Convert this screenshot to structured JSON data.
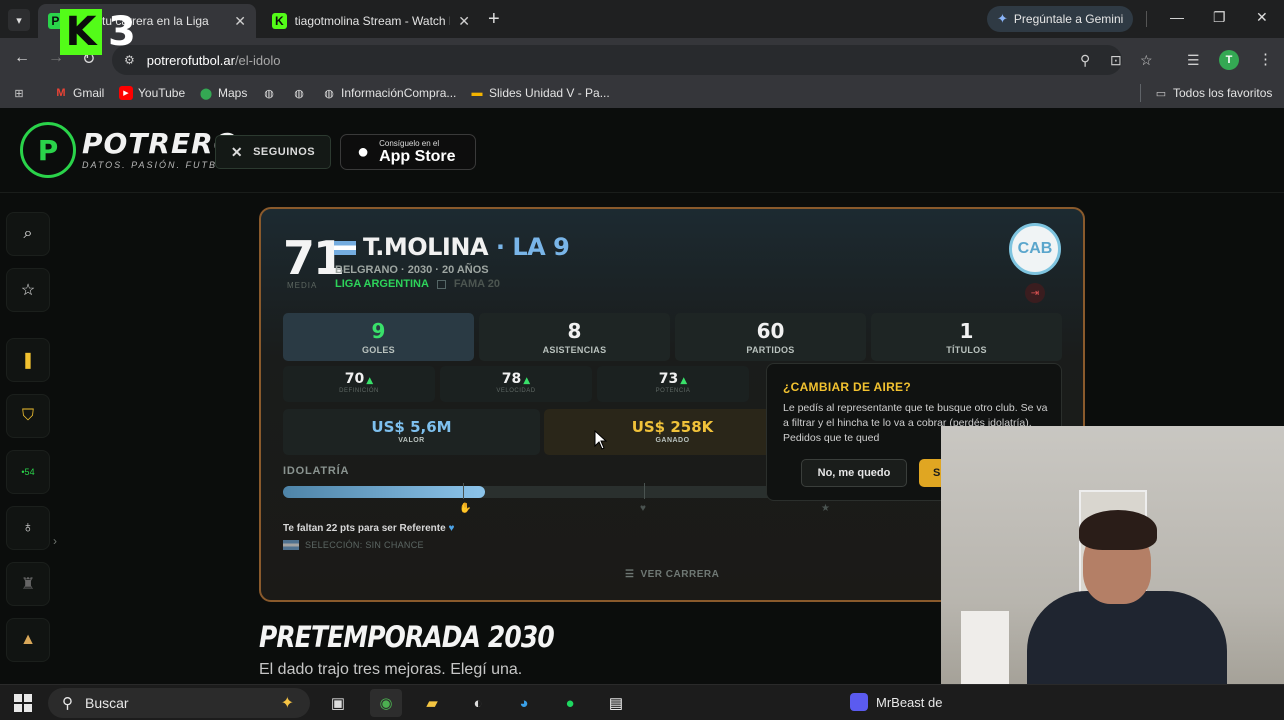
{
  "browser": {
    "tabs": [
      {
        "title": "Hacé tu carrera en la Liga",
        "active": true
      },
      {
        "title": "tiagotmolina Stream - Watch Li",
        "active": false
      }
    ],
    "new_tab": "+",
    "gemini_label": "Pregúntale a Gemini",
    "url_host": "potrerofutbol.ar",
    "url_path": "/el-idolo",
    "profile_initial": "T",
    "bookmarks": [
      "Gmail",
      "YouTube",
      "Maps",
      "InformaciónCompra...",
      "Slides Unidad V - Pa..."
    ],
    "all_bookmarks": "Todos los favoritos"
  },
  "overlay_logo": {
    "letter": "K",
    "number": "3"
  },
  "site": {
    "brand": "POTRERO",
    "tagline": "DATOS. PASIÓN. FUTBOL.",
    "follow_label": "SEGUINOS",
    "appstore_small": "Consíguelo en el",
    "appstore_big": "App Store"
  },
  "player": {
    "rating": "71",
    "rating_label": "MEDIA",
    "name": "T.MOLINA",
    "position": "· LA 9",
    "meta": "BELGRANO · 2030 · 20 AÑOS",
    "league": "LIGA ARGENTINA",
    "fama": "FAMA 20",
    "stats": [
      {
        "value": "9",
        "label": "GOLES"
      },
      {
        "value": "8",
        "label": "ASISTENCIAS"
      },
      {
        "value": "60",
        "label": "PARTIDOS"
      },
      {
        "value": "1",
        "label": "TÍTULOS"
      }
    ],
    "attributes": [
      {
        "value": "70",
        "label": "DEFINICIÓN"
      },
      {
        "value": "78",
        "label": "VELOCIDAD"
      },
      {
        "value": "73",
        "label": "POTENCIA"
      }
    ],
    "money": [
      {
        "value": "US$ 5,6M",
        "label": "VALOR",
        "color": "#7ec0ee"
      },
      {
        "value": "US$ 258K",
        "label": "GANADO",
        "color": "#f0c23a"
      }
    ],
    "idolatria_label": "IDOLATRÍA",
    "idolatria_progress": 0.36,
    "idolatria_hint": "Te faltan 22 pts para ser Referente",
    "seleccion": "SELECCIÓN: SIN CHANCE",
    "ver_carrera": "VER CARRERA"
  },
  "popup": {
    "title": "¿CAMBIAR DE AIRE?",
    "body": "Le pedís al representante que te busque otro club. Se va a filtrar y el hincha te lo va a cobrar (perdés idolatría). Pedidos que te qued",
    "no_label": "No, me quedo",
    "yes_label": "S"
  },
  "section": {
    "title": "PRETEMPORADA 2030",
    "subtitle": "El dado trajo tres mejoras. Elegí una."
  },
  "taskbar": {
    "search_placeholder": "Buscar",
    "media_title": "MrBeast de"
  },
  "colors": {
    "accent_green": "#2ad34a",
    "card_border": "#8a5a2c",
    "popup_title": "#f2c230"
  }
}
